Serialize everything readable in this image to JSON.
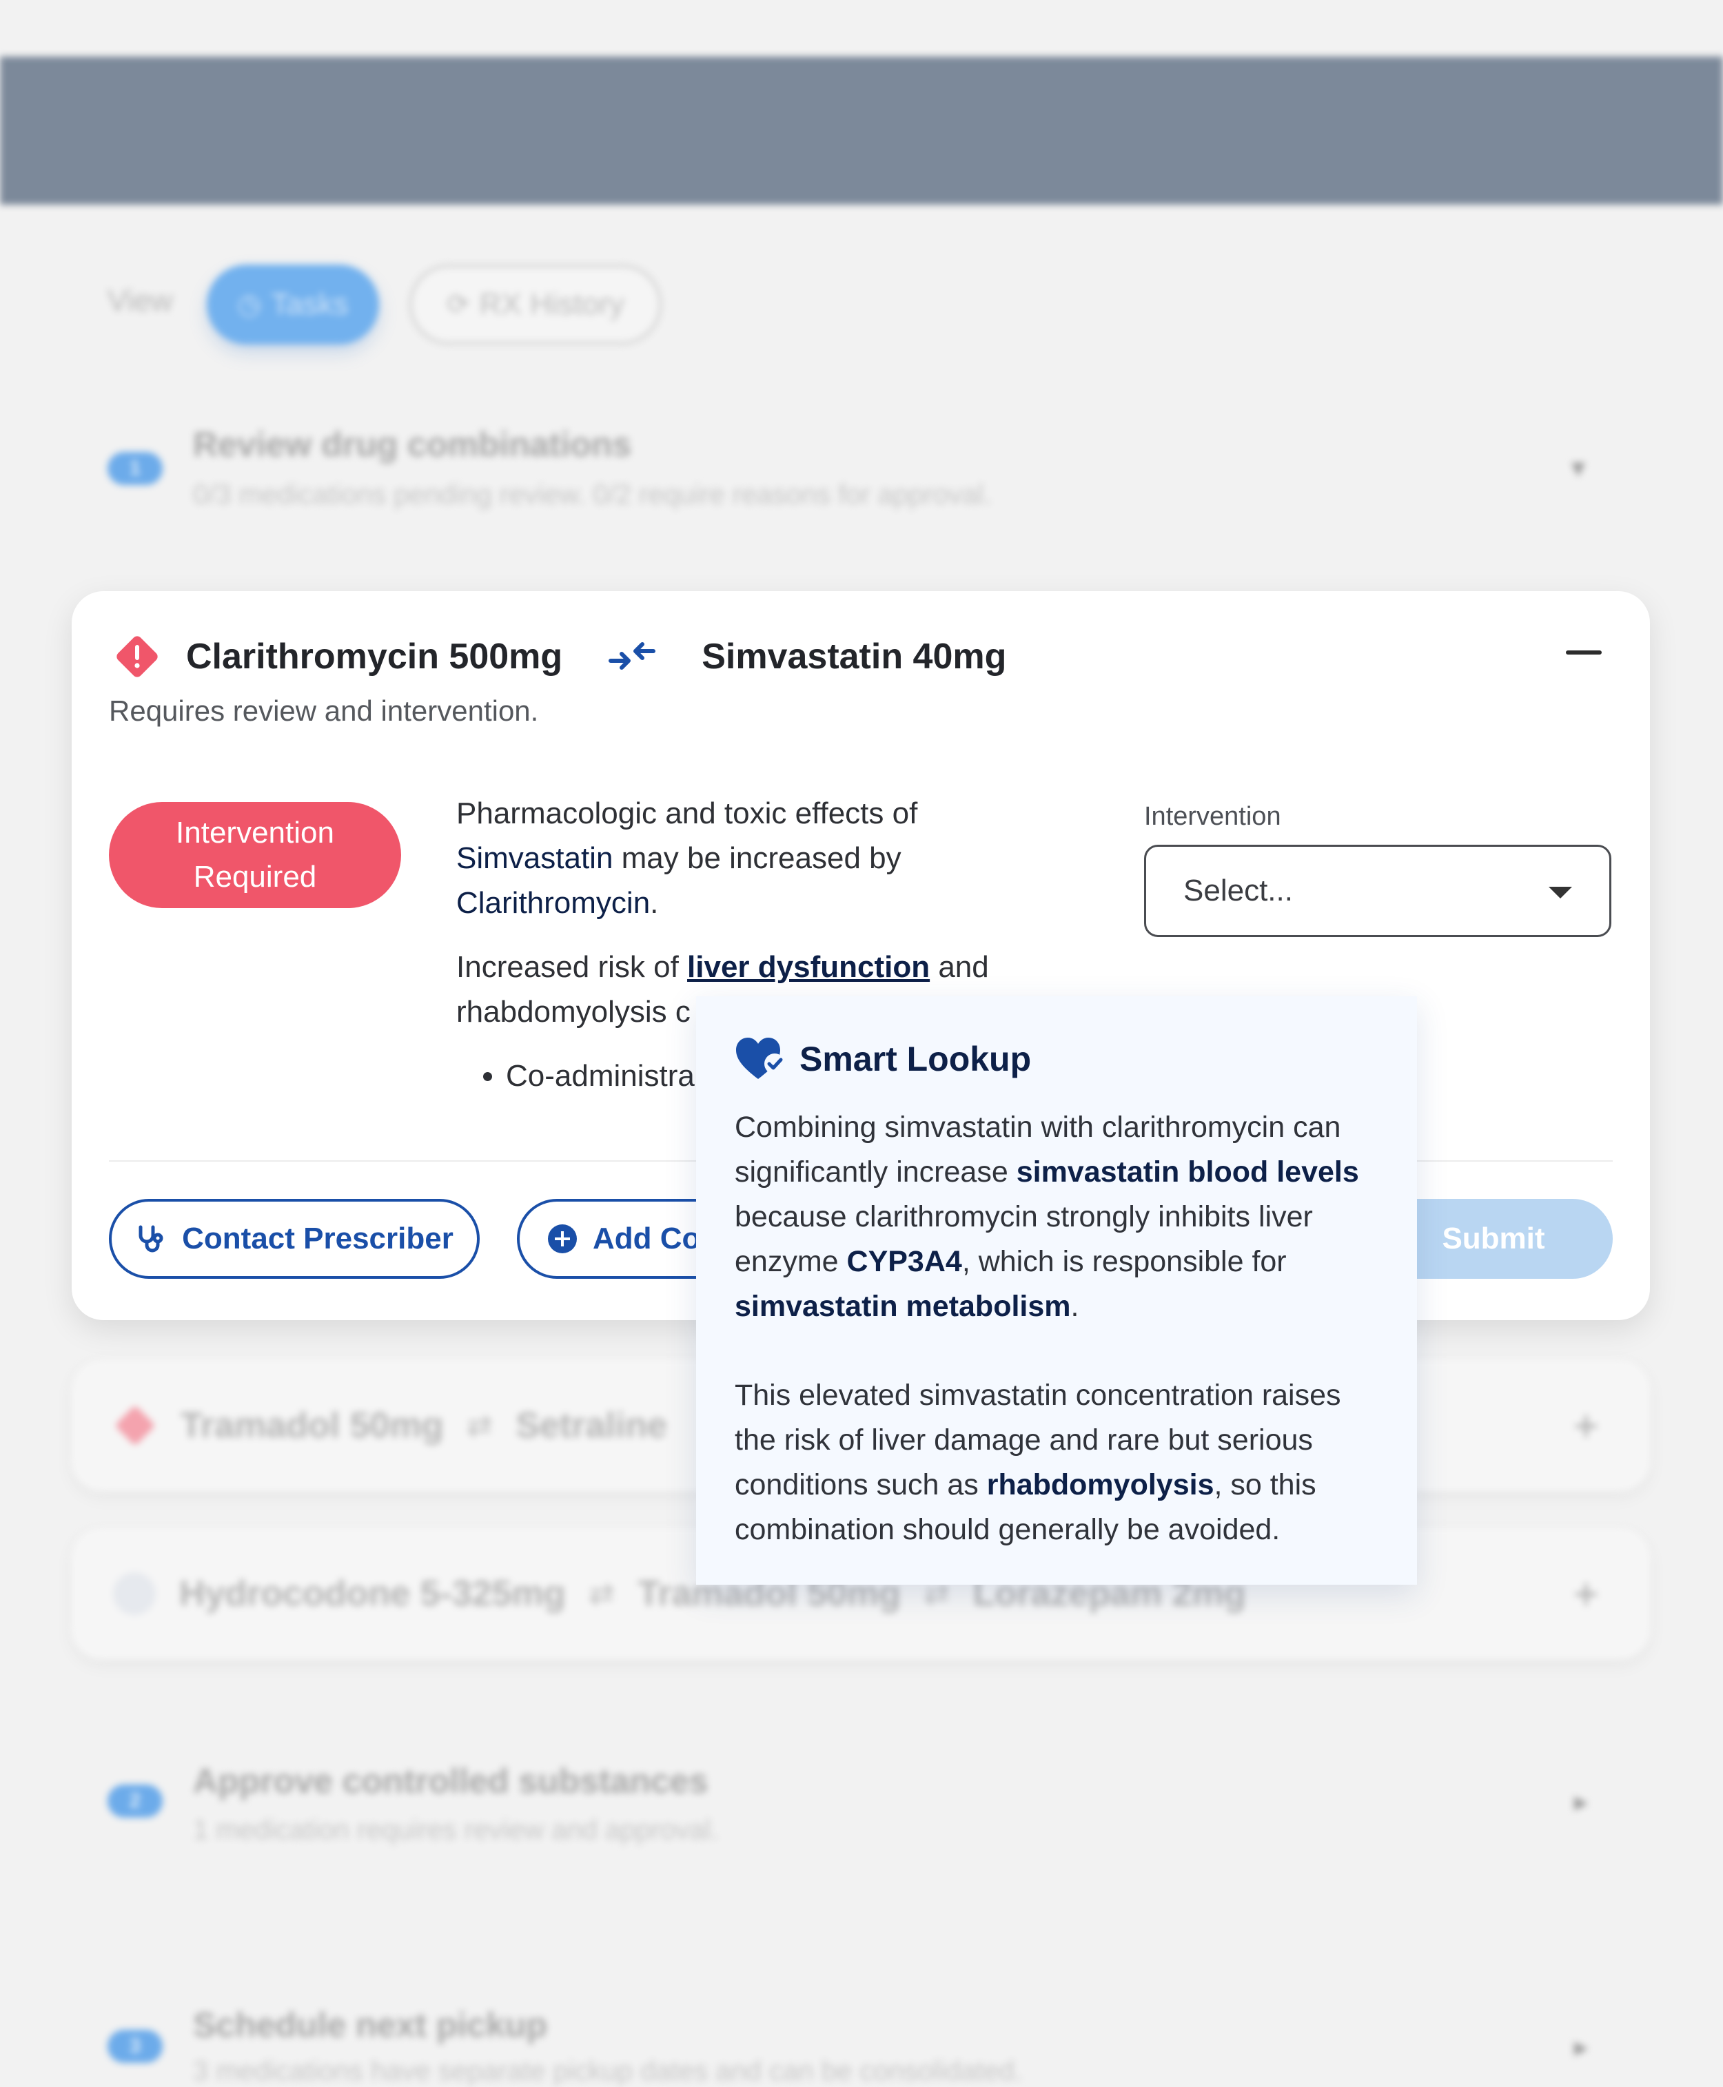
{
  "view": {
    "label": "View",
    "tabs": [
      {
        "label": "Tasks",
        "icon": "clock-icon",
        "active": true
      },
      {
        "label": "RX History",
        "icon": "history-icon",
        "active": false
      }
    ]
  },
  "steps": [
    {
      "number": "1",
      "title": "Review drug combinations",
      "subtitle": "0/3 medications pending review. 0/2 require reasons for approval."
    },
    {
      "number": "2",
      "title": "Approve controlled substances",
      "subtitle": "1 medication requires review and approval."
    },
    {
      "number": "3",
      "title": "Schedule next pickup",
      "subtitle": "3 medications have separate pickup dates and can be consolidated."
    }
  ],
  "active_interaction": {
    "drug_a": "Clarithromycin 500mg",
    "drug_b": "Simvastatin 40mg",
    "subtitle": "Requires review and intervention.",
    "badge_line1": "Intervention",
    "badge_line2": "Required",
    "desc1_pre": "Pharmacologic and toxic effects of ",
    "desc1_b1": "Simvastatin",
    "desc1_mid": " may be increased by ",
    "desc1_b2": "Clarithromycin",
    "desc1_post": ".",
    "desc2_pre": "Increased risk of ",
    "desc2_link": "liver dysfunction",
    "desc2_post": " and",
    "desc2_line2": "rhabdomyolysis c",
    "bullet": "Co-administra",
    "intervention_label": "Intervention",
    "intervention_placeholder": "Select...",
    "contact_label": "Contact Prescriber",
    "add_label": "Add Co",
    "submit_label": "Submit"
  },
  "other_interactions": [
    {
      "drugs": [
        "Tramadol 50mg",
        "Setraline"
      ],
      "status": "warning"
    },
    {
      "drugs": [
        "Hydrocodone 5-325mg",
        "Tramadol 50mg",
        "Lorazepam 2mg"
      ],
      "status": "info"
    }
  ],
  "smart_lookup": {
    "title": "Smart Lookup",
    "p1_a": "Combining simvastatin with clarithromycin can significantly increase ",
    "p1_b1": "simvastatin blood levels",
    "p1_c": " because clarithromycin strongly inhibits liver enzyme ",
    "p1_b2": "CYP3A4",
    "p1_d": ", which is responsible for ",
    "p1_b3": "simvastatin metabolism",
    "p1_e": ".",
    "p2_a": "This elevated simvastatin concentration raises the risk of liver damage and rare but serious conditions such as ",
    "p2_b1": "rhabdomyolysis",
    "p2_c": ", so this combination should generally be avoided."
  },
  "colors": {
    "header_bar": "#7c899a",
    "accent_blue": "#1a4fa8",
    "danger_red": "#f0566a",
    "navy_text": "#0d2048"
  }
}
